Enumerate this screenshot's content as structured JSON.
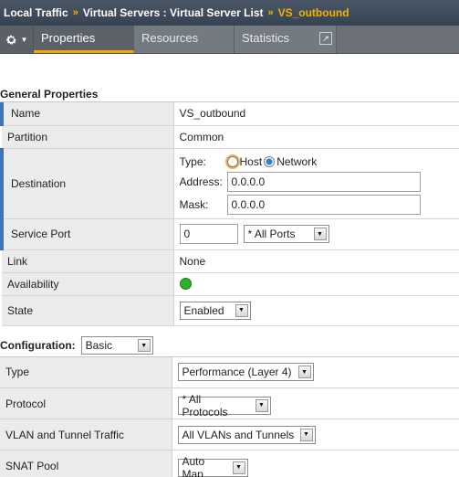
{
  "breadcrumb": {
    "items": [
      "Local Traffic",
      "Virtual Servers : Virtual Server List",
      "VS_outbound"
    ],
    "separator": "»"
  },
  "tabs": [
    {
      "label": "Properties"
    },
    {
      "label": "Resources"
    },
    {
      "label": "Statistics"
    }
  ],
  "general": {
    "title": "General Properties",
    "name": {
      "label": "Name",
      "value": "VS_outbound"
    },
    "partition": {
      "label": "Partition",
      "value": "Common"
    },
    "destination": {
      "label": "Destination",
      "type_label": "Type:",
      "host_label": "Host",
      "network_label": "Network",
      "address_label": "Address:",
      "address_value": "0.0.0.0",
      "mask_label": "Mask:",
      "mask_value": "0.0.0.0"
    },
    "service_port": {
      "label": "Service Port",
      "value": "0",
      "select": "* All Ports"
    },
    "link": {
      "label": "Link",
      "value": "None"
    },
    "availability": {
      "label": "Availability",
      "status_color": "#2bb12b"
    },
    "state": {
      "label": "State",
      "value": "Enabled"
    }
  },
  "configuration": {
    "title": "Configuration:",
    "mode": "Basic",
    "type": {
      "label": "Type",
      "value": "Performance (Layer 4)"
    },
    "protocol": {
      "label": "Protocol",
      "value": "* All Protocols"
    },
    "vlan": {
      "label": "VLAN and Tunnel Traffic",
      "value": "All VLANs and Tunnels"
    },
    "snat": {
      "label": "SNAT Pool",
      "value": "Auto Map"
    }
  }
}
